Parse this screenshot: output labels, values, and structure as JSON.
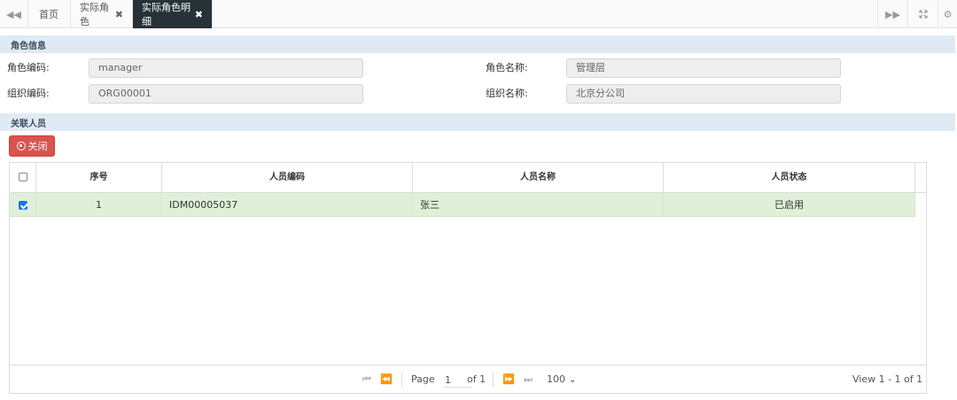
{
  "tabs": {
    "items": [
      {
        "label": "首页"
      },
      {
        "label": "实际角色",
        "close": "✖"
      },
      {
        "label": "实际角色明细",
        "close": "✖",
        "active": true
      }
    ]
  },
  "role_info": {
    "section_title": "角色信息",
    "role_code_label": "角色编码:",
    "role_code_value": "manager",
    "role_name_label": "角色名称:",
    "role_name_value": "管理层",
    "org_code_label": "组织编码:",
    "org_code_value": "ORG00001",
    "org_name_label": "组织名称:",
    "org_name_value": "北京分公司"
  },
  "related": {
    "section_title": "关联人员",
    "close_label": "关闭"
  },
  "grid": {
    "columns": [
      "序号",
      "人员编码",
      "人员名称",
      "人员状态"
    ],
    "rows": [
      {
        "index": "1",
        "code": "IDM00005037",
        "name": "张三",
        "status": "已启用",
        "checked": true
      }
    ]
  },
  "pager": {
    "page_label": "Page",
    "page_value": "1",
    "of_label": "of 1",
    "page_size": "100",
    "view_text": "View 1 - 1 of 1"
  },
  "colors": {
    "active_tab": "#263238",
    "section_bg": "#dfeaf5",
    "close_button": "#d9534f",
    "selected_row": "#dff0d8"
  }
}
